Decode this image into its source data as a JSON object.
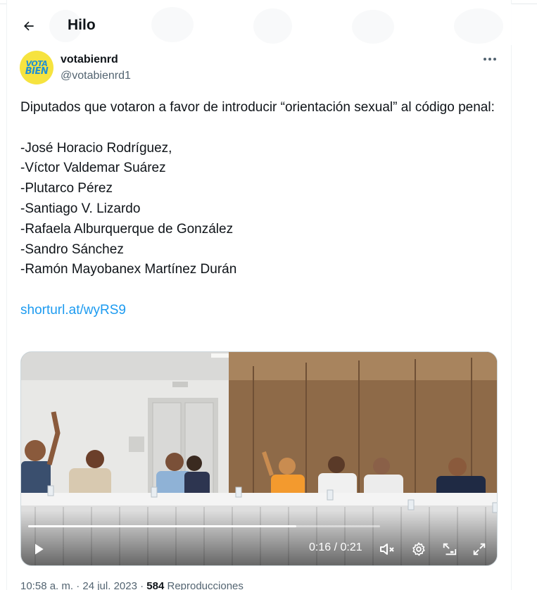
{
  "header": {
    "title": "Hilo",
    "back_icon": "arrow-left-icon"
  },
  "author": {
    "display_name": "votabienrd",
    "handle": "@votabienrd1",
    "avatar": {
      "line1": "VOTA",
      "line2": "BIEN",
      "bg_color": "#f6e33f",
      "text_color": "#1f8fd6"
    },
    "more_icon": "more-horizontal-icon"
  },
  "tweet": {
    "intro": "Diputados que votaron a favor de introducir “orientación sexual” al código penal:",
    "names": [
      "-José Horacio Rodríguez,",
      "-Víctor Valdemar Suárez",
      "-Plutarco Pérez",
      "-Santiago V. Lizardo",
      "-Rafaela Alburquerque de González",
      "-Sandro Sánchez",
      "-Ramón Mayobanex Martínez Durán"
    ],
    "link": "shorturl.at/wyRS9",
    "link_color": "#1d9bf0"
  },
  "video": {
    "time_label": "0:16 / 0:21",
    "progress_fraction": 0.762,
    "play_icon": "play-icon",
    "mute_icon": "volume-muted-icon",
    "settings_icon": "gear-icon",
    "pip_icon": "picture-in-picture-icon",
    "fullscreen_icon": "fullscreen-expand-icon"
  },
  "meta": {
    "time": "10:58 a. m. · 24 jul. 2023 · ",
    "views_count": "584",
    "views_label": " Reproducciones"
  }
}
